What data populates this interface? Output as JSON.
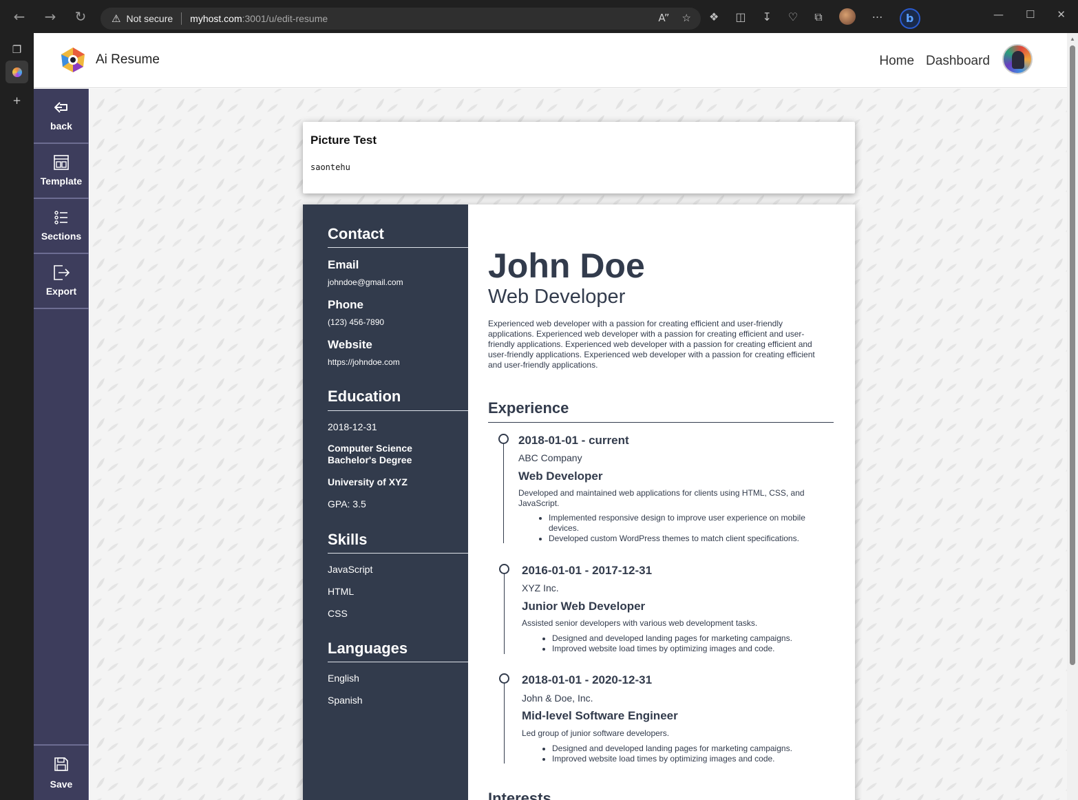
{
  "browser": {
    "security_label": "Not secure",
    "url_host": "myhost.com",
    "url_path": ":3001/u/edit-resume"
  },
  "header": {
    "brand": "Ai Resume",
    "nav": [
      "Home",
      "Dashboard"
    ]
  },
  "sidebar": {
    "items": [
      {
        "label": "back",
        "icon": "back-arrow-icon"
      },
      {
        "label": "Template",
        "icon": "template-icon"
      },
      {
        "label": "Sections",
        "icon": "list-icon"
      },
      {
        "label": "Export",
        "icon": "export-icon"
      }
    ],
    "save_label": "Save"
  },
  "picture_card": {
    "title": "Picture Test",
    "text": "saontehu"
  },
  "resume": {
    "left": {
      "contact_heading": "Contact",
      "email_label": "Email",
      "email": "johndoe@gmail.com",
      "phone_label": "Phone",
      "phone": "(123) 456-7890",
      "website_label": "Website",
      "website": "https://johndoe.com",
      "education_heading": "Education",
      "edu_date": "2018-12-31",
      "edu_degree": "Computer Science Bachelor's Degree",
      "edu_degree_line1": "Computer Science",
      "edu_degree_line2": "Bachelor's Degree",
      "edu_school": "University of XYZ",
      "edu_gpa": "GPA: 3.5",
      "skills_heading": "Skills",
      "skills": [
        "JavaScript",
        "HTML",
        "CSS"
      ],
      "languages_heading": "Languages",
      "languages": [
        "English",
        "Spanish"
      ]
    },
    "name": "John Doe",
    "title": "Web Developer",
    "summary": "Experienced web developer with a passion for creating efficient and user-friendly applications. Experienced web developer with a passion for creating efficient and user-friendly applications. Experienced web developer with a passion for creating efficient and user-friendly applications. Experienced web developer with a passion for creating efficient and user-friendly applications.",
    "experience_heading": "Experience",
    "jobs": [
      {
        "date": "2018-01-01 - current",
        "company": "ABC Company",
        "title": "Web Developer",
        "desc": "Developed and maintained web applications for clients using HTML, CSS, and JavaScript.",
        "bullets": [
          "Implemented responsive design to improve user experience on mobile devices.",
          "Developed custom WordPress themes to match client specifications."
        ]
      },
      {
        "date": "2016-01-01 - 2017-12-31",
        "company": "XYZ Inc.",
        "title": "Junior Web Developer",
        "desc": "Assisted senior developers with various web development tasks.",
        "bullets": [
          "Designed and developed landing pages for marketing campaigns.",
          "Improved website load times by optimizing images and code."
        ]
      },
      {
        "date": "2018-01-01 - 2020-12-31",
        "company": "John & Doe, Inc.",
        "title": "Mid-level Software Engineer",
        "desc": "Led group of junior software developers.",
        "bullets": [
          "Designed and developed landing pages for marketing campaigns.",
          "Improved website load times by optimizing images and code."
        ]
      }
    ],
    "next_heading": "Interests"
  },
  "colors": {
    "sidebar_bg": "#3d3d5c",
    "resume_dark": "#323b4c"
  }
}
